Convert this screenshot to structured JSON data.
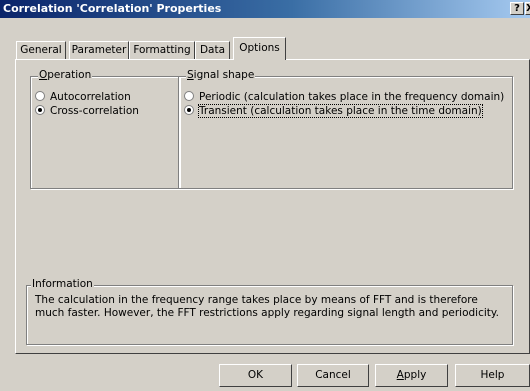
{
  "window": {
    "title": "Correlation 'Correlation' Properties",
    "help_button": "?",
    "close_button": "X"
  },
  "tabs": [
    {
      "label": "General",
      "active": false
    },
    {
      "label": "Parameter",
      "active": false
    },
    {
      "label": "Formatting",
      "active": false
    },
    {
      "label": "Data",
      "active": false
    },
    {
      "label": "Options",
      "active": true
    }
  ],
  "operation": {
    "label_access_key": "O",
    "label_rest": "peration",
    "options": [
      {
        "label": "Autocorrelation",
        "checked": false
      },
      {
        "label": "Cross-correlation",
        "checked": true
      }
    ]
  },
  "signal_shape": {
    "label_access_key": "S",
    "label_rest": "ignal shape",
    "options": [
      {
        "label": "Periodic (calculation takes place in the frequency domain)",
        "checked": false
      },
      {
        "label": "Transient (calculation takes place in the time domain)",
        "checked": true
      }
    ]
  },
  "information": {
    "label": "Information",
    "text": "The calculation in the frequency range takes place by means of FFT and is therefore much faster. However, the FFT restrictions apply regarding signal length and periodicity."
  },
  "buttons": {
    "ok": "OK",
    "cancel": "Cancel",
    "apply_access_key": "A",
    "apply_rest": "pply",
    "help": "Help"
  }
}
